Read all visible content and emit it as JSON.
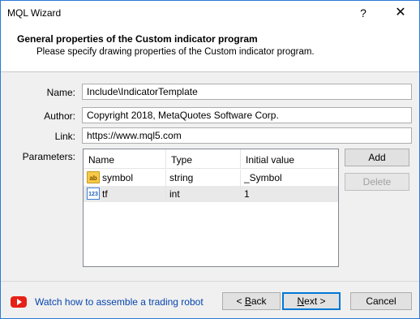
{
  "window": {
    "title": "MQL Wizard",
    "help_glyph": "?",
    "close_glyph": "✕"
  },
  "header": {
    "title": "General properties of the Custom indicator program",
    "subtitle": "Please specify drawing properties of the Custom indicator program."
  },
  "form": {
    "name_label": "Name:",
    "name_value": "Include\\IndicatorTemplate",
    "author_label": "Author:",
    "author_value": "Copyright 2018, MetaQuotes Software Corp.",
    "link_label": "Link:",
    "link_value": "https://www.mql5.com",
    "parameters_label": "Parameters:"
  },
  "parameters": {
    "columns": [
      "Name",
      "Type",
      "Initial value"
    ],
    "rows": [
      {
        "icon": "string-type-icon",
        "icon_text": "ab",
        "name": "symbol",
        "type": "string",
        "initial": "_Symbol",
        "selected": false
      },
      {
        "icon": "int-type-icon",
        "icon_text": "123",
        "name": "tf",
        "type": "int",
        "initial": "1",
        "selected": true
      }
    ]
  },
  "side_buttons": {
    "add": "Add",
    "delete": "Delete"
  },
  "footer": {
    "video_icon": "youtube-icon",
    "link_text": "Watch how to assemble a trading robot",
    "back_prefix": "< ",
    "back_key": "B",
    "back_rest": "ack",
    "next_key": "N",
    "next_rest": "ext >",
    "cancel": "Cancel"
  },
  "colors": {
    "accent": "#0078d7",
    "link": "#0645ad",
    "youtube": "#e62117"
  }
}
